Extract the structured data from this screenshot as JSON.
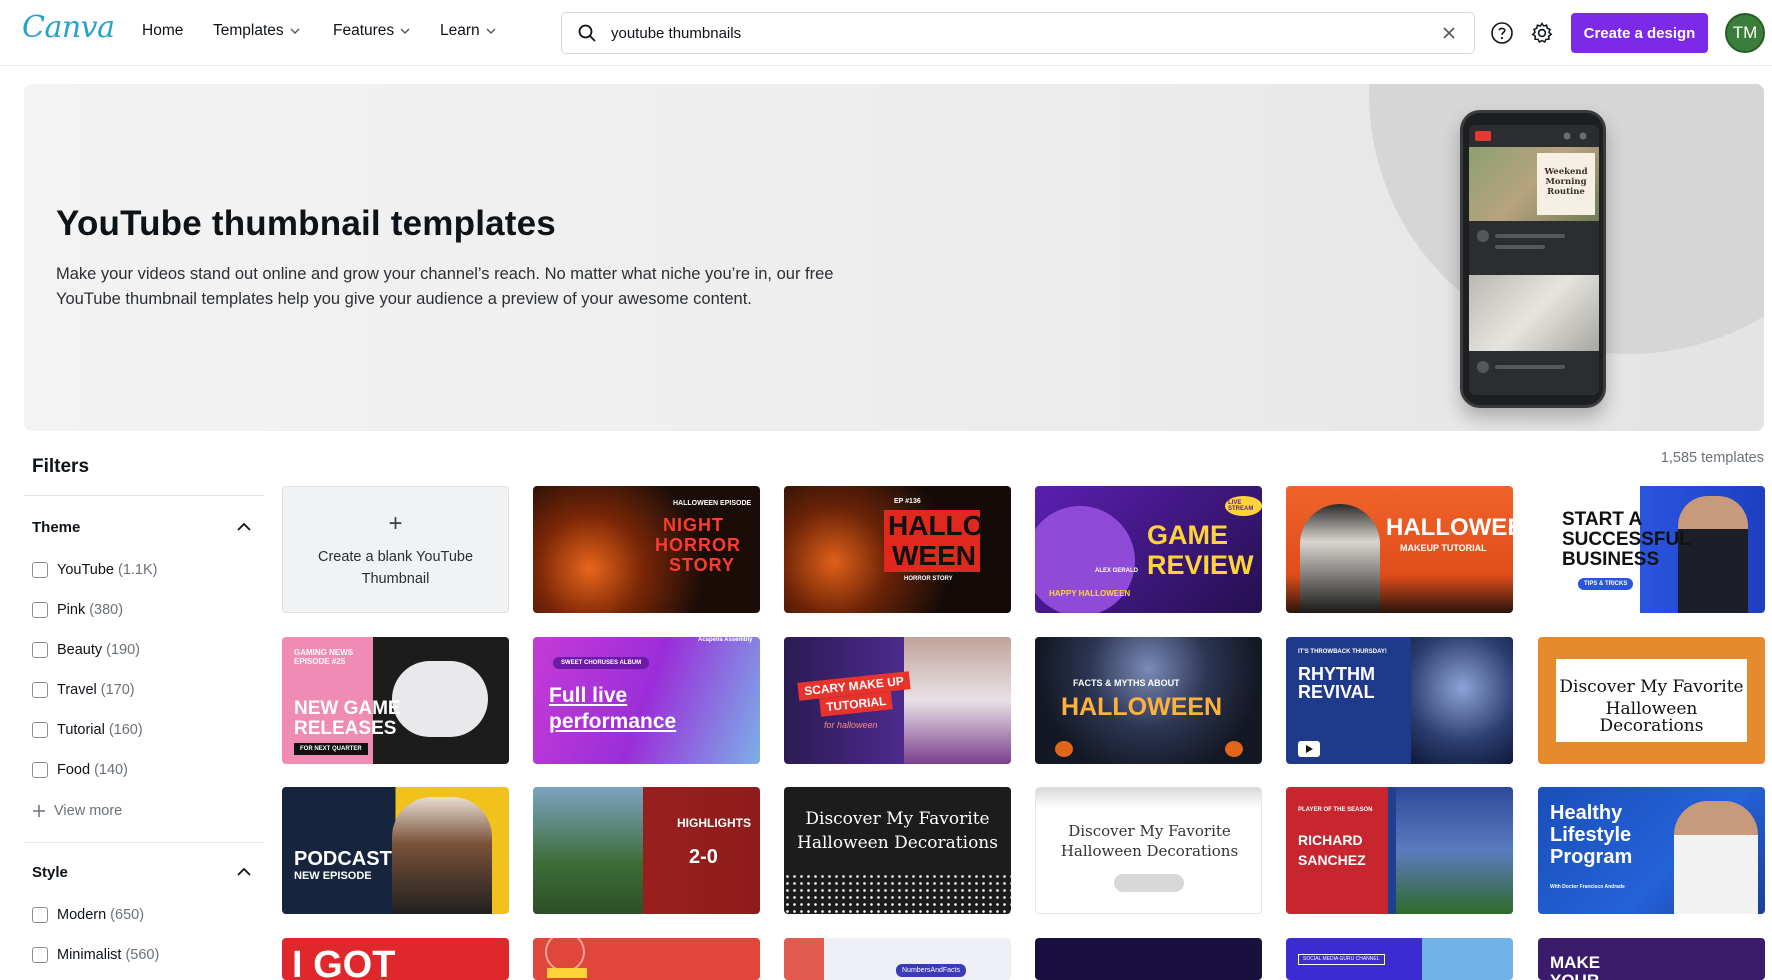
{
  "header": {
    "logo": "Canva",
    "nav": [
      {
        "label": "Home",
        "dropdown": false
      },
      {
        "label": "Templates",
        "dropdown": true
      },
      {
        "label": "Features",
        "dropdown": true
      },
      {
        "label": "Learn",
        "dropdown": true
      }
    ],
    "search_value": "youtube thumbnails",
    "create_label": "Create a design",
    "avatar_initials": "TM",
    "accent": "#7d2ae8"
  },
  "hero": {
    "title": "YouTube thumbnail templates",
    "description": "Make your videos stand out online and grow your channel’s reach. No matter what niche you’re in, our free YouTube thumbnail templates help you give your audience a preview of your awesome content.",
    "phone_card": "Weekend Morning Routine"
  },
  "filters": {
    "title": "Filters",
    "sections": [
      {
        "title": "Theme",
        "options": [
          {
            "label": "YouTube",
            "count": "(1.1K)"
          },
          {
            "label": "Pink",
            "count": "(380)"
          },
          {
            "label": "Beauty",
            "count": "(190)"
          },
          {
            "label": "Travel",
            "count": "(170)"
          },
          {
            "label": "Tutorial",
            "count": "(160)"
          },
          {
            "label": "Food",
            "count": "(140)"
          }
        ]
      },
      {
        "title": "Style",
        "options": [
          {
            "label": "Modern",
            "count": "(650)"
          },
          {
            "label": "Minimalist",
            "count": "(560)"
          }
        ]
      }
    ],
    "view_more": "View more"
  },
  "results": {
    "count": "1,585 templates",
    "blank_label": "Create a blank YouTube Thumbnail",
    "tiles": [
      {
        "texts": [
          "HALLOWEEN EPISODE",
          "NIGHT",
          "HORROR",
          "STORY"
        ]
      },
      {
        "texts": [
          "EP #136",
          "HALLO",
          "WEEN",
          "HORROR STORY"
        ]
      },
      {
        "texts": [
          "LIVE STREAM",
          "GAME",
          "REVIEW",
          "ALEX GERALD",
          "HAPPY HALLOWEEN"
        ]
      },
      {
        "texts": [
          "HALLOWEEN",
          "MAKEUP TUTORIAL"
        ]
      },
      {
        "texts": [
          "START A",
          "SUCCESSFUL",
          "BUSINESS",
          "TIPS & TRICKS"
        ]
      },
      {
        "texts": [
          "GAMING NEWS EPISODE #25",
          "NEW GAME",
          "RELEASES",
          "FOR NEXT QUARTER"
        ]
      },
      {
        "texts": [
          "SWEET CHORUSES ALBUM",
          "Acapella Assembly",
          "Full live",
          "performance"
        ]
      },
      {
        "texts": [
          "SCARY MAKE UP",
          "TUTORIAL",
          "for halloween"
        ]
      },
      {
        "texts": [
          "FACTS & MYTHS ABOUT",
          "HALLOWEEN"
        ]
      },
      {
        "texts": [
          "IT'S THROWBACK THURSDAY!",
          "RHYTHM",
          "REVIVAL"
        ]
      },
      {
        "texts": [
          "Discover My Favorite",
          "Halloween Decorations"
        ]
      },
      {
        "texts": [
          "PODCAST",
          "NEW EPISODE"
        ]
      },
      {
        "texts": [
          "HIGHLIGHTS",
          "2-0"
        ]
      },
      {
        "texts": [
          "Discover My Favorite",
          "Halloween Decorations"
        ]
      },
      {
        "texts": [
          "Discover My Favorite",
          "Halloween Decorations"
        ]
      },
      {
        "texts": [
          "PLAYER OF THE SEASON",
          "RICHARD",
          "SANCHEZ"
        ]
      },
      {
        "texts": [
          "Healthy",
          "Lifestyle",
          "Program",
          "With Doctor Francisco Andrade"
        ]
      },
      {
        "texts": [
          "I GOT"
        ]
      },
      {
        "texts": [
          ""
        ]
      },
      {
        "texts": [
          "NumbersAndFacts"
        ]
      },
      {
        "texts": [
          ""
        ]
      },
      {
        "texts": [
          "SOCIAL MEDIA GURU CHANNEL"
        ]
      },
      {
        "texts": [
          "MAKE",
          "YOUR"
        ]
      }
    ]
  }
}
